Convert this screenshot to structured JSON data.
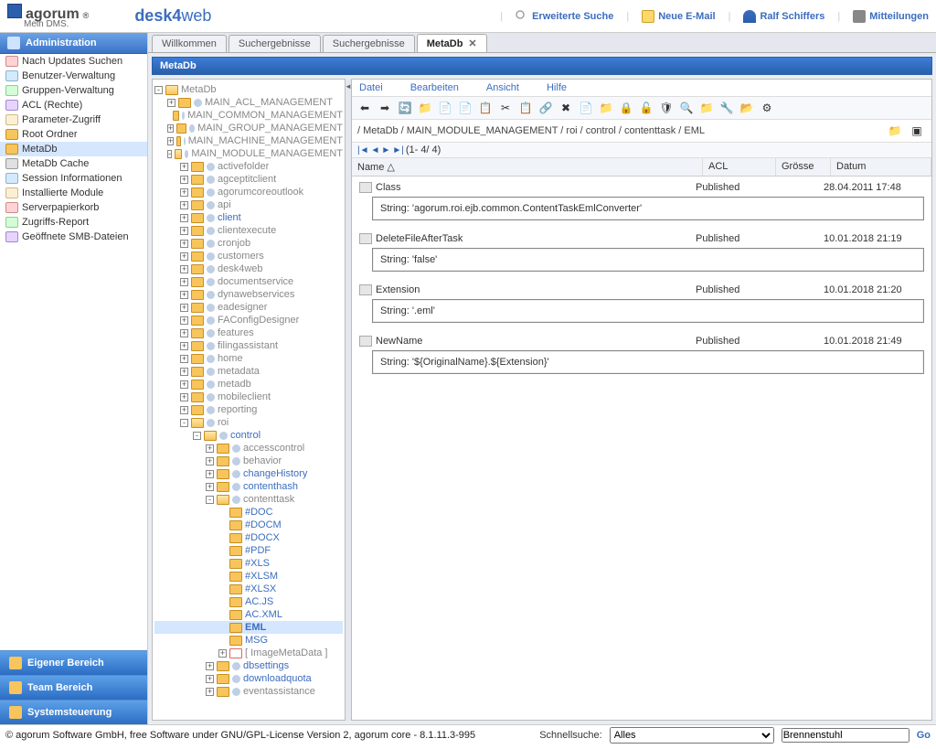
{
  "header": {
    "logo_text": "agorum",
    "logo_sub": "Mein DMS.",
    "app_name_bold": "desk4",
    "app_name_rest": "web",
    "links": {
      "search": "Erweiterte Suche",
      "mail": "Neue E-Mail",
      "user": "Ralf Schiffers",
      "notifications": "Mitteilungen"
    }
  },
  "sidebar": {
    "title": "Administration",
    "items": [
      "Nach Updates Suchen",
      "Benutzer-Verwaltung",
      "Gruppen-Verwaltung",
      "ACL (Rechte)",
      "Parameter-Zugriff",
      "Root Ordner",
      "MetaDb",
      "MetaDb Cache",
      "Session Informationen",
      "Installierte Module",
      "Serverpapierkorb",
      "Zugriffs-Report",
      "Geöffnete SMB-Dateien"
    ],
    "bottom": [
      "Eigener Bereich",
      "Team Bereich",
      "Systemsteuerung"
    ]
  },
  "tabs": [
    "Willkommen",
    "Suchergebnisse",
    "Suchergebnisse",
    "MetaDb"
  ],
  "active_tab": 3,
  "panel_title": "MetaDb",
  "tree": {
    "root": "MetaDb",
    "level1": [
      {
        "label": "MAIN_ACL_MANAGEMENT",
        "exp": "+"
      },
      {
        "label": "MAIN_COMMON_MANAGEMENT",
        "exp": ""
      },
      {
        "label": "MAIN_GROUP_MANAGEMENT",
        "exp": "+"
      },
      {
        "label": "MAIN_MACHINE_MANAGEMENT",
        "exp": "+"
      },
      {
        "label": "MAIN_MODULE_MANAGEMENT",
        "exp": "-"
      }
    ],
    "module_children": [
      "activefolder",
      "agceptitclient",
      "agorumcoreoutlook",
      "api",
      "client",
      "clientexecute",
      "cronjob",
      "customers",
      "desk4web",
      "documentservice",
      "dynawebservices",
      "eadesigner",
      "FAConfigDesigner",
      "features",
      "filingassistant",
      "home",
      "metadata",
      "metadb",
      "mobileclient",
      "reporting",
      "roi"
    ],
    "client_link_index": 4,
    "roi_children": [
      "control"
    ],
    "control_children": [
      "accesscontrol",
      "behavior",
      "changeHistory",
      "contenthash",
      "contenttask"
    ],
    "control_link_indices": [
      2,
      3
    ],
    "contenttask_children": [
      "#DOC",
      "#DOCM",
      "#DOCX",
      "#PDF",
      "#XLS",
      "#XLSM",
      "#XLSX",
      "AC.JS",
      "AC.XML",
      "EML",
      "MSG"
    ],
    "selected_contenttask": "EML",
    "imagemetadata": "[ ImageMetaData ]",
    "after_control": [
      "dbsettings",
      "downloadquota",
      "eventassistance"
    ],
    "after_control_links": [
      0,
      1
    ]
  },
  "menu": [
    "Datei",
    "Bearbeiten",
    "Ansicht",
    "Hilfe"
  ],
  "crumb": "/ MetaDb / MAIN_MODULE_MANAGEMENT / roi / control / contenttask / EML",
  "pager": "(1- 4/ 4)",
  "grid": {
    "cols": [
      "Name",
      "ACL",
      "Grösse",
      "Datum"
    ],
    "sort_indicator": "△",
    "rows": [
      {
        "name": "Class",
        "acl": "Published",
        "size": "",
        "date": "28.04.2011 17:48",
        "detail": "String: 'agorum.roi.ejb.common.ContentTaskEmlConverter'"
      },
      {
        "name": "DeleteFileAfterTask",
        "acl": "Published",
        "size": "",
        "date": "10.01.2018 21:19",
        "detail": "String: 'false'"
      },
      {
        "name": "Extension",
        "acl": "Published",
        "size": "",
        "date": "10.01.2018 21:20",
        "detail": "String: '.eml'"
      },
      {
        "name": "NewName",
        "acl": "Published",
        "size": "",
        "date": "10.01.2018 21:49",
        "detail": "String: '${OriginalName}.${Extension}'"
      }
    ]
  },
  "footer": {
    "copy": "© agorum Software GmbH, free Software under GNU/GPL-License Version 2, agorum core - 8.1.11.3-995",
    "quicksearch_label": "Schnellsuche:",
    "quicksearch_sel": "Alles",
    "quicksearch_value": "Brennenstuhl",
    "go": "Go"
  }
}
